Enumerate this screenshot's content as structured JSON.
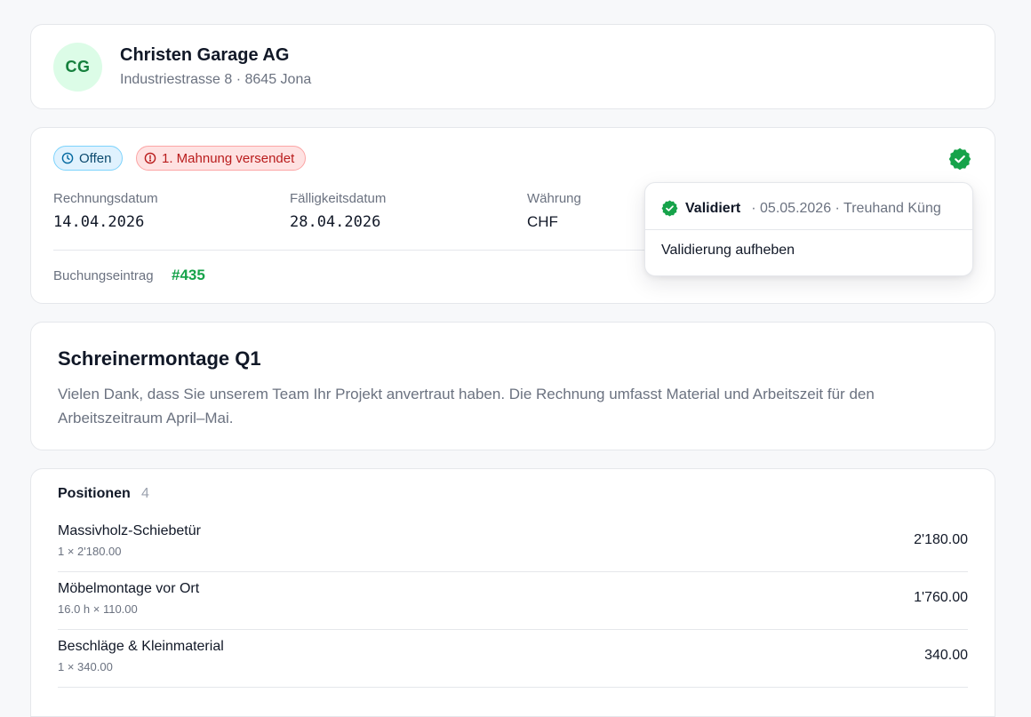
{
  "customer": {
    "initials": "CG",
    "name": "Christen Garage AG",
    "address": "Industriestrasse 8 · 8645 Jona"
  },
  "status": {
    "open_label": "Offen",
    "dunning_label": "1. Mahnung versendet"
  },
  "invoice_meta": {
    "invoice_date_label": "Rechnungsdatum",
    "invoice_date": "14.04.2026",
    "due_date_label": "Fälligkeitsdatum",
    "due_date": "28.04.2026",
    "currency_label": "Währung",
    "currency": "CHF",
    "booking_label": "Buchungseintrag",
    "booking_ref": "#435"
  },
  "validation_popover": {
    "status": "Validiert",
    "meta": "· 05.05.2026 · Treuhand Küng",
    "action": "Validierung aufheben"
  },
  "description": {
    "title": "Schreinermontage Q1",
    "text": "Vielen Dank, dass Sie unserem Team Ihr Projekt anvertraut haben. Die Rechnung umfasst Material und Arbeitszeit für den Arbeitszeitraum April–Mai."
  },
  "positions": {
    "header": "Positionen",
    "count": "4",
    "items": [
      {
        "name": "Massivholz-Schiebetür",
        "detail": "1 × 2'180.00",
        "amount": "2'180.00"
      },
      {
        "name": "Möbelmontage vor Ort",
        "detail": "16.0 h × 110.00",
        "amount": "1'760.00"
      },
      {
        "name": "Beschläge & Kleinmaterial",
        "detail": "1 × 340.00",
        "amount": "340.00"
      }
    ]
  },
  "colors": {
    "success": "#16a34a",
    "danger": "#b91c1c",
    "info": "#0c4a6e"
  },
  "icons": {
    "open_badge": "clock-icon",
    "dunning_badge": "alert-circle-icon",
    "verified": "verified-badge-icon"
  }
}
